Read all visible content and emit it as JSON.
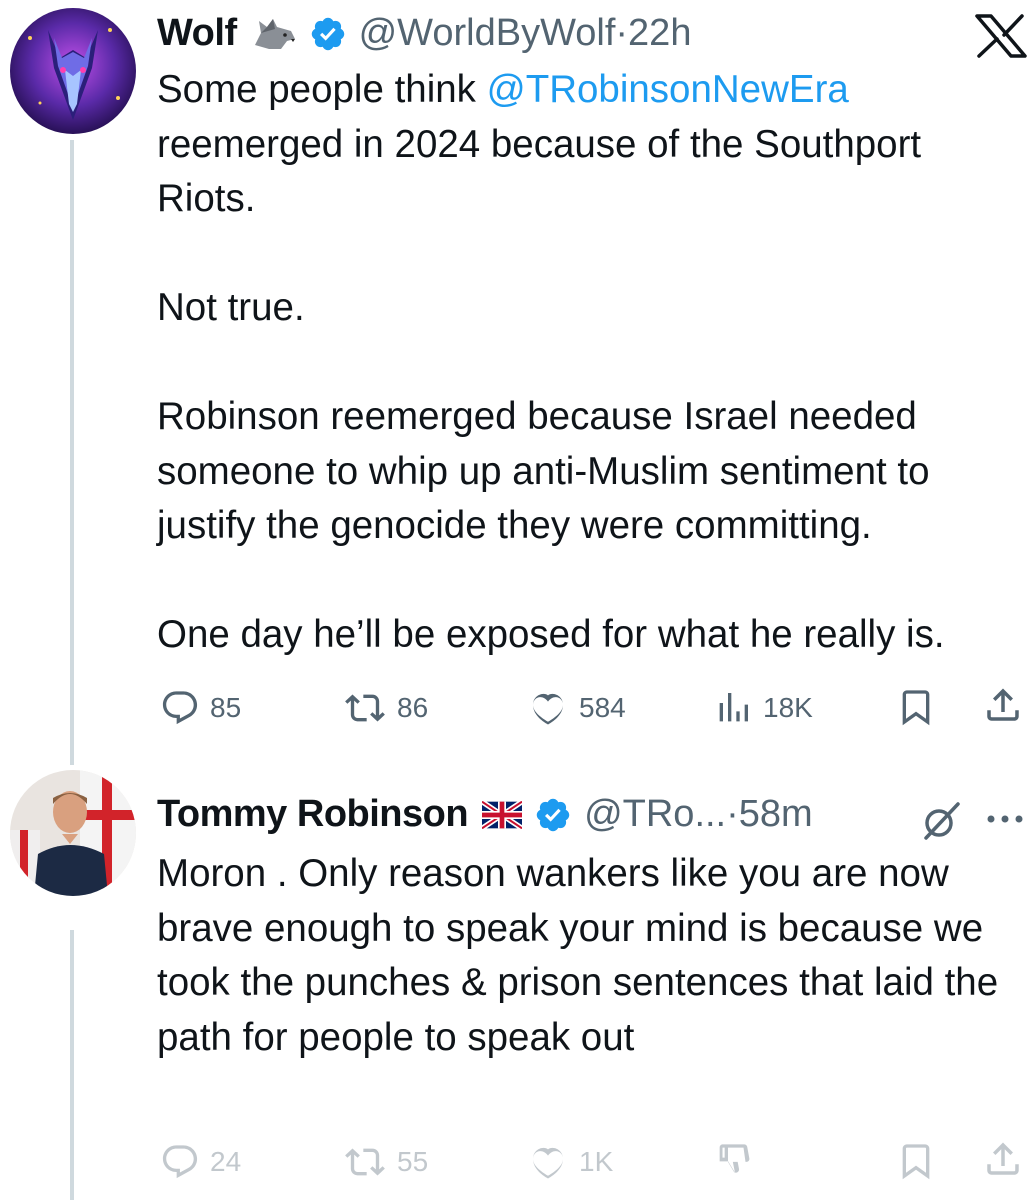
{
  "tweet1": {
    "name": "Wolf",
    "name_emoji": "wolf",
    "handle": "@WorldByWolf",
    "time": "22h",
    "text_intro": "Some people think ",
    "mention": "@TRobinsonNewEra",
    "text_line_rest": " reemerged in 2024 because of the Southport Riots.",
    "paragraph2": "Not true.",
    "paragraph3": "Robinson reemerged because Israel needed someone to whip up anti-Muslim sentiment to justify the genocide they were committing.",
    "paragraph4": "One day he’ll be exposed for what he really is.",
    "replies": "85",
    "reposts": "86",
    "likes": "584",
    "views": "18K"
  },
  "tweet2": {
    "name": "Tommy Robinson",
    "name_emoji": "uk-flag",
    "handle": "@TRo...",
    "time": "58m",
    "text": "Moron . Only reason wankers like you are now brave enough to speak your mind is because we took the punches & prison sentences that laid the path for people to speak out",
    "replies": "24",
    "reposts": "55",
    "likes": "1K"
  },
  "separator": " · ",
  "colors": {
    "accent": "#1d9bf0",
    "text": "#0f1419",
    "muted": "#536471",
    "line": "#cfd9de"
  }
}
